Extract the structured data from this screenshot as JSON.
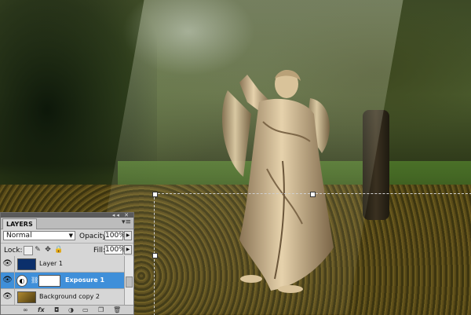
{
  "layers_panel": {
    "tab_label": "LAYERS",
    "panel_controls": "◂◂ ✕",
    "menu_icon": "panel-menu-icon",
    "blend_mode": "Normal",
    "opacity_label": "Opacity:",
    "opacity_value": "100%",
    "lock_label": "Lock:",
    "fill_label": "Fill:",
    "fill_value": "100%",
    "layers": [
      {
        "name": "Layer 1",
        "thumb_color": "#0b2f6b",
        "selected": false
      },
      {
        "name": "Exposure 1",
        "thumb_color": "#ffffff",
        "selected": true
      },
      {
        "name": "Background copy 2",
        "thumb_color": "#8a6a20",
        "selected": false
      }
    ],
    "bottom_icons": [
      "link-icon",
      "fx-icon",
      "mask-icon",
      "adjustment-icon",
      "folder-icon",
      "new-layer-icon",
      "trash-icon"
    ]
  },
  "colors": {
    "selection_highlight": "#3f8fd9",
    "panel_bg": "#d6d6d6"
  }
}
